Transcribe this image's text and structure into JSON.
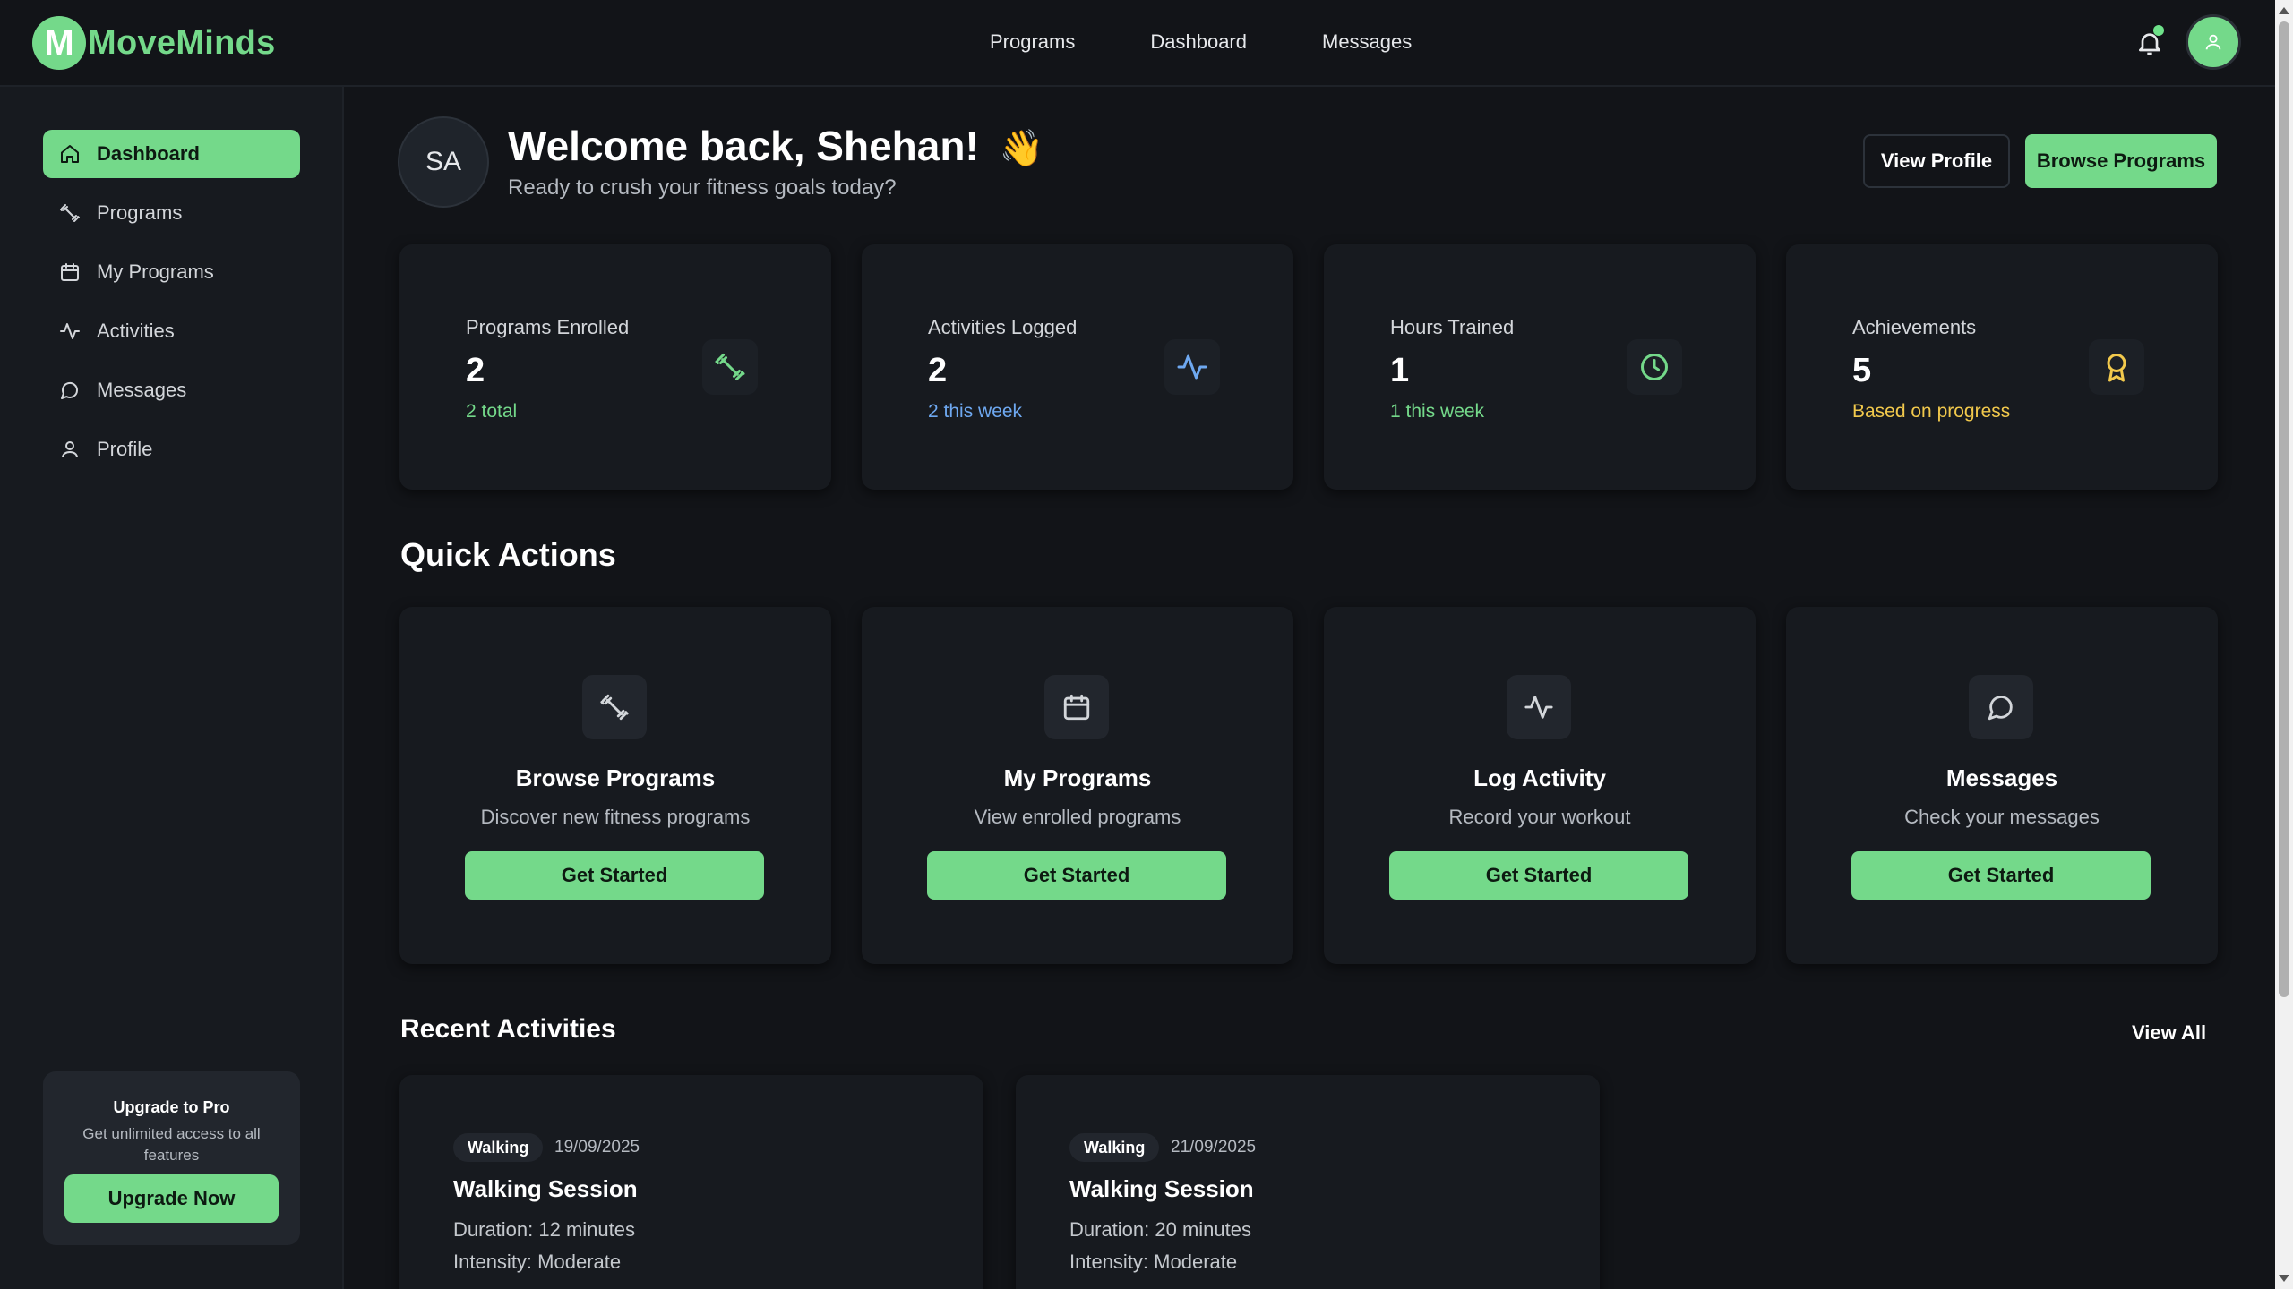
{
  "brand": {
    "logo_letter": "M",
    "name": "MoveMinds",
    "accent": "#74d98a"
  },
  "topnav": {
    "items": [
      "Programs",
      "Dashboard",
      "Messages"
    ]
  },
  "sidebar": {
    "items": [
      {
        "label": "Dashboard",
        "icon": "home-icon",
        "active": true
      },
      {
        "label": "Programs",
        "icon": "dumbbell-icon"
      },
      {
        "label": "My Programs",
        "icon": "calendar-icon"
      },
      {
        "label": "Activities",
        "icon": "activity-icon"
      },
      {
        "label": "Messages",
        "icon": "message-icon"
      },
      {
        "label": "Profile",
        "icon": "user-icon"
      }
    ],
    "upgrade": {
      "title": "Upgrade to Pro",
      "description": "Get unlimited access to all features",
      "button": "Upgrade Now"
    }
  },
  "header": {
    "avatar_initials": "SA",
    "welcome": "Welcome back, Shehan!",
    "wave_emoji": "👋",
    "subtitle": "Ready to crush your fitness goals today?",
    "view_profile": "View Profile",
    "browse_programs": "Browse Programs"
  },
  "stats": [
    {
      "label": "Programs Enrolled",
      "value": "2",
      "sub": "2 total",
      "sub_color": "#74d98a",
      "icon": "dumbbell-icon",
      "icon_color": "#74d98a"
    },
    {
      "label": "Activities Logged",
      "value": "2",
      "sub": "2 this week",
      "sub_color": "#6ea8f0",
      "icon": "activity-icon",
      "icon_color": "#6ea8f0"
    },
    {
      "label": "Hours Trained",
      "value": "1",
      "sub": "1 this week",
      "sub_color": "#74d98a",
      "icon": "clock-icon",
      "icon_color": "#74d98a"
    },
    {
      "label": "Achievements",
      "value": "5",
      "sub": "Based on progress",
      "sub_color": "#f2c94c",
      "icon": "award-icon",
      "icon_color": "#f2c94c"
    }
  ],
  "quick_actions": {
    "title": "Quick Actions",
    "items": [
      {
        "title": "Browse Programs",
        "description": "Discover new fitness programs",
        "button": "Get Started",
        "icon": "dumbbell-icon"
      },
      {
        "title": "My Programs",
        "description": "View enrolled programs",
        "button": "Get Started",
        "icon": "calendar-icon"
      },
      {
        "title": "Log Activity",
        "description": "Record your workout",
        "button": "Get Started",
        "icon": "activity-icon"
      },
      {
        "title": "Messages",
        "description": "Check your messages",
        "button": "Get Started",
        "icon": "message-icon"
      }
    ]
  },
  "recent_activities": {
    "title": "Recent Activities",
    "view_all": "View All",
    "items": [
      {
        "badge": "Walking",
        "date": "19/09/2025",
        "title": "Walking Session",
        "duration": "Duration: 12 minutes",
        "intensity": "Intensity: Moderate"
      },
      {
        "badge": "Walking",
        "date": "21/09/2025",
        "title": "Walking Session",
        "duration": "Duration: 20 minutes",
        "intensity": "Intensity: Moderate"
      }
    ]
  }
}
